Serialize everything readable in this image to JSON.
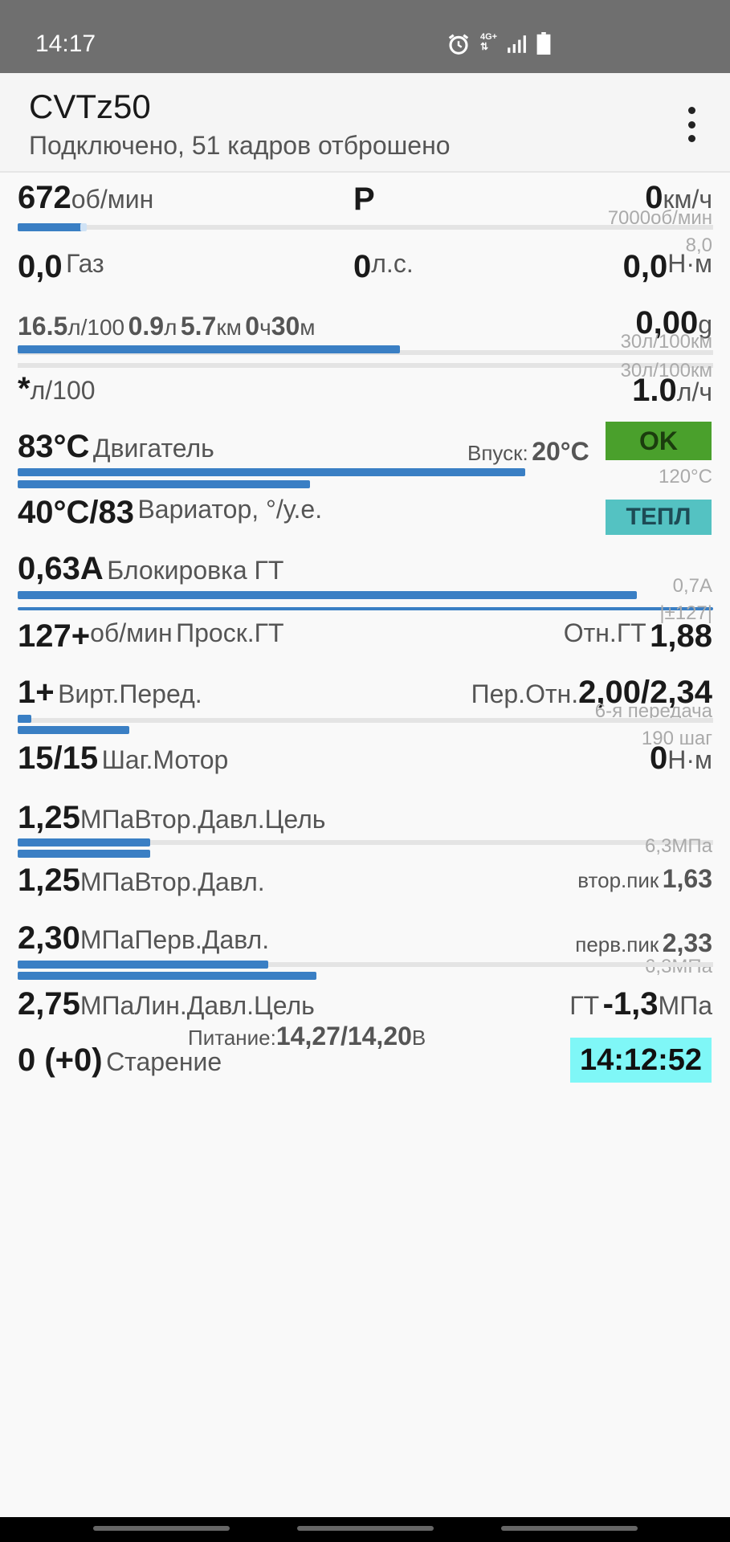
{
  "status_bar": {
    "time": "14:17",
    "network": "4G+",
    "icons": [
      "alarm-icon",
      "network-4g-icon",
      "signal-icon",
      "battery-icon"
    ]
  },
  "app": {
    "title": "CVTz50",
    "subtitle": "Подключено, 51 кадров отброшено",
    "menu_icon": "more-vert-icon"
  },
  "rows": {
    "rpm": {
      "value": "672",
      "unit": "об/мин",
      "gear": "P",
      "speed": "0",
      "speed_unit": "км/ч",
      "scale": "7000об/мин",
      "level": 0.096
    },
    "throttle": {
      "value": "0,0",
      "label": "Газ",
      "power": "0",
      "power_unit": "л.с.",
      "torque": "0,0",
      "torque_unit": "Н·м",
      "scale": "8,0"
    },
    "fuel": {
      "l100": "16.5",
      "l100_unit": "л/100",
      "liters": "0.9",
      "liters_unit": "л",
      "km": "5.7",
      "km_unit": "км",
      "hours": "0",
      "hours_unit": "ч",
      "minutes": "30",
      "minutes_unit": "м",
      "accel": "0,00",
      "accel_unit": "g",
      "scale1": "30л/100км",
      "scale2": "30л/100км",
      "level": 0.55
    },
    "instant": {
      "value": "*",
      "unit": "л/100",
      "hourly": "1.0",
      "hourly_unit": "л/ч"
    },
    "engine_temp": {
      "value": "83°C",
      "label": "Двигатель",
      "intake_label": "Впуск:",
      "intake_value": "20°C",
      "status": "OK",
      "scale": "120°C",
      "level1": 0.73,
      "level2": 0.42,
      "status_color": "#4aa02c"
    },
    "cvt_temp": {
      "value": "40°C/83",
      "label": "Вариатор, °/у.е.",
      "status": "ТЕПЛ",
      "status_color": "#54c2c2"
    },
    "lockup": {
      "value": "0,63А",
      "label": "Блокировка ГТ",
      "scale": "0,7А",
      "level": 0.89
    },
    "slip": {
      "value": "127+",
      "unit": "об/мин",
      "label": "Проск.ГТ",
      "scale": "|±127|",
      "ratio_label": "Отн.ГТ",
      "ratio_value": "1,88"
    },
    "virt_gear": {
      "value": "1+",
      "label": "Вирт.Перед.",
      "ratio_label": "Пер.Отн.",
      "ratio_value": "2,00/2,34",
      "scale": "6-я передача",
      "level1": 0.02,
      "level2": 0.16
    },
    "step_motor": {
      "value": "15/15",
      "label": "Шаг.Мотор",
      "torque": "0",
      "torque_unit": "Н·м",
      "scale": "190 шаг"
    },
    "sec_target": {
      "value": "1,25",
      "unit": "МПа",
      "label": "Втор.Давл.Цель",
      "level": 0.19
    },
    "sec_pressure": {
      "value": "1,25",
      "unit": "МПа",
      "label": "Втор.Давл.",
      "scale": "6,3МПа",
      "peak_label": "втор.пик",
      "peak_value": "1,63",
      "level": 0.19
    },
    "pri_pressure": {
      "value": "2,30",
      "unit": "МПа",
      "label": "Перв.Давл.",
      "peak_label": "перв.пик",
      "peak_value": "2,33",
      "scale": "6,3МПа",
      "level1": 0.36,
      "level2": 0.43
    },
    "line_pressure": {
      "value": "2,75",
      "unit": "МПа",
      "label": "Лин.Давл.Цель",
      "gt_label": "ГТ",
      "gt_value": "-1,3",
      "gt_unit": "МПа"
    },
    "supply": {
      "label": "Питание:",
      "value": "14,27/14,20",
      "unit": "В"
    },
    "aging": {
      "value": "0 (+0)",
      "label": "Старение",
      "clock": "14:12:52",
      "clock_color": "#7ff7f7"
    }
  },
  "colors": {
    "bar": "#3a7fc4",
    "track": "#e4e4e4",
    "status_bar": "#6f6f6f"
  }
}
